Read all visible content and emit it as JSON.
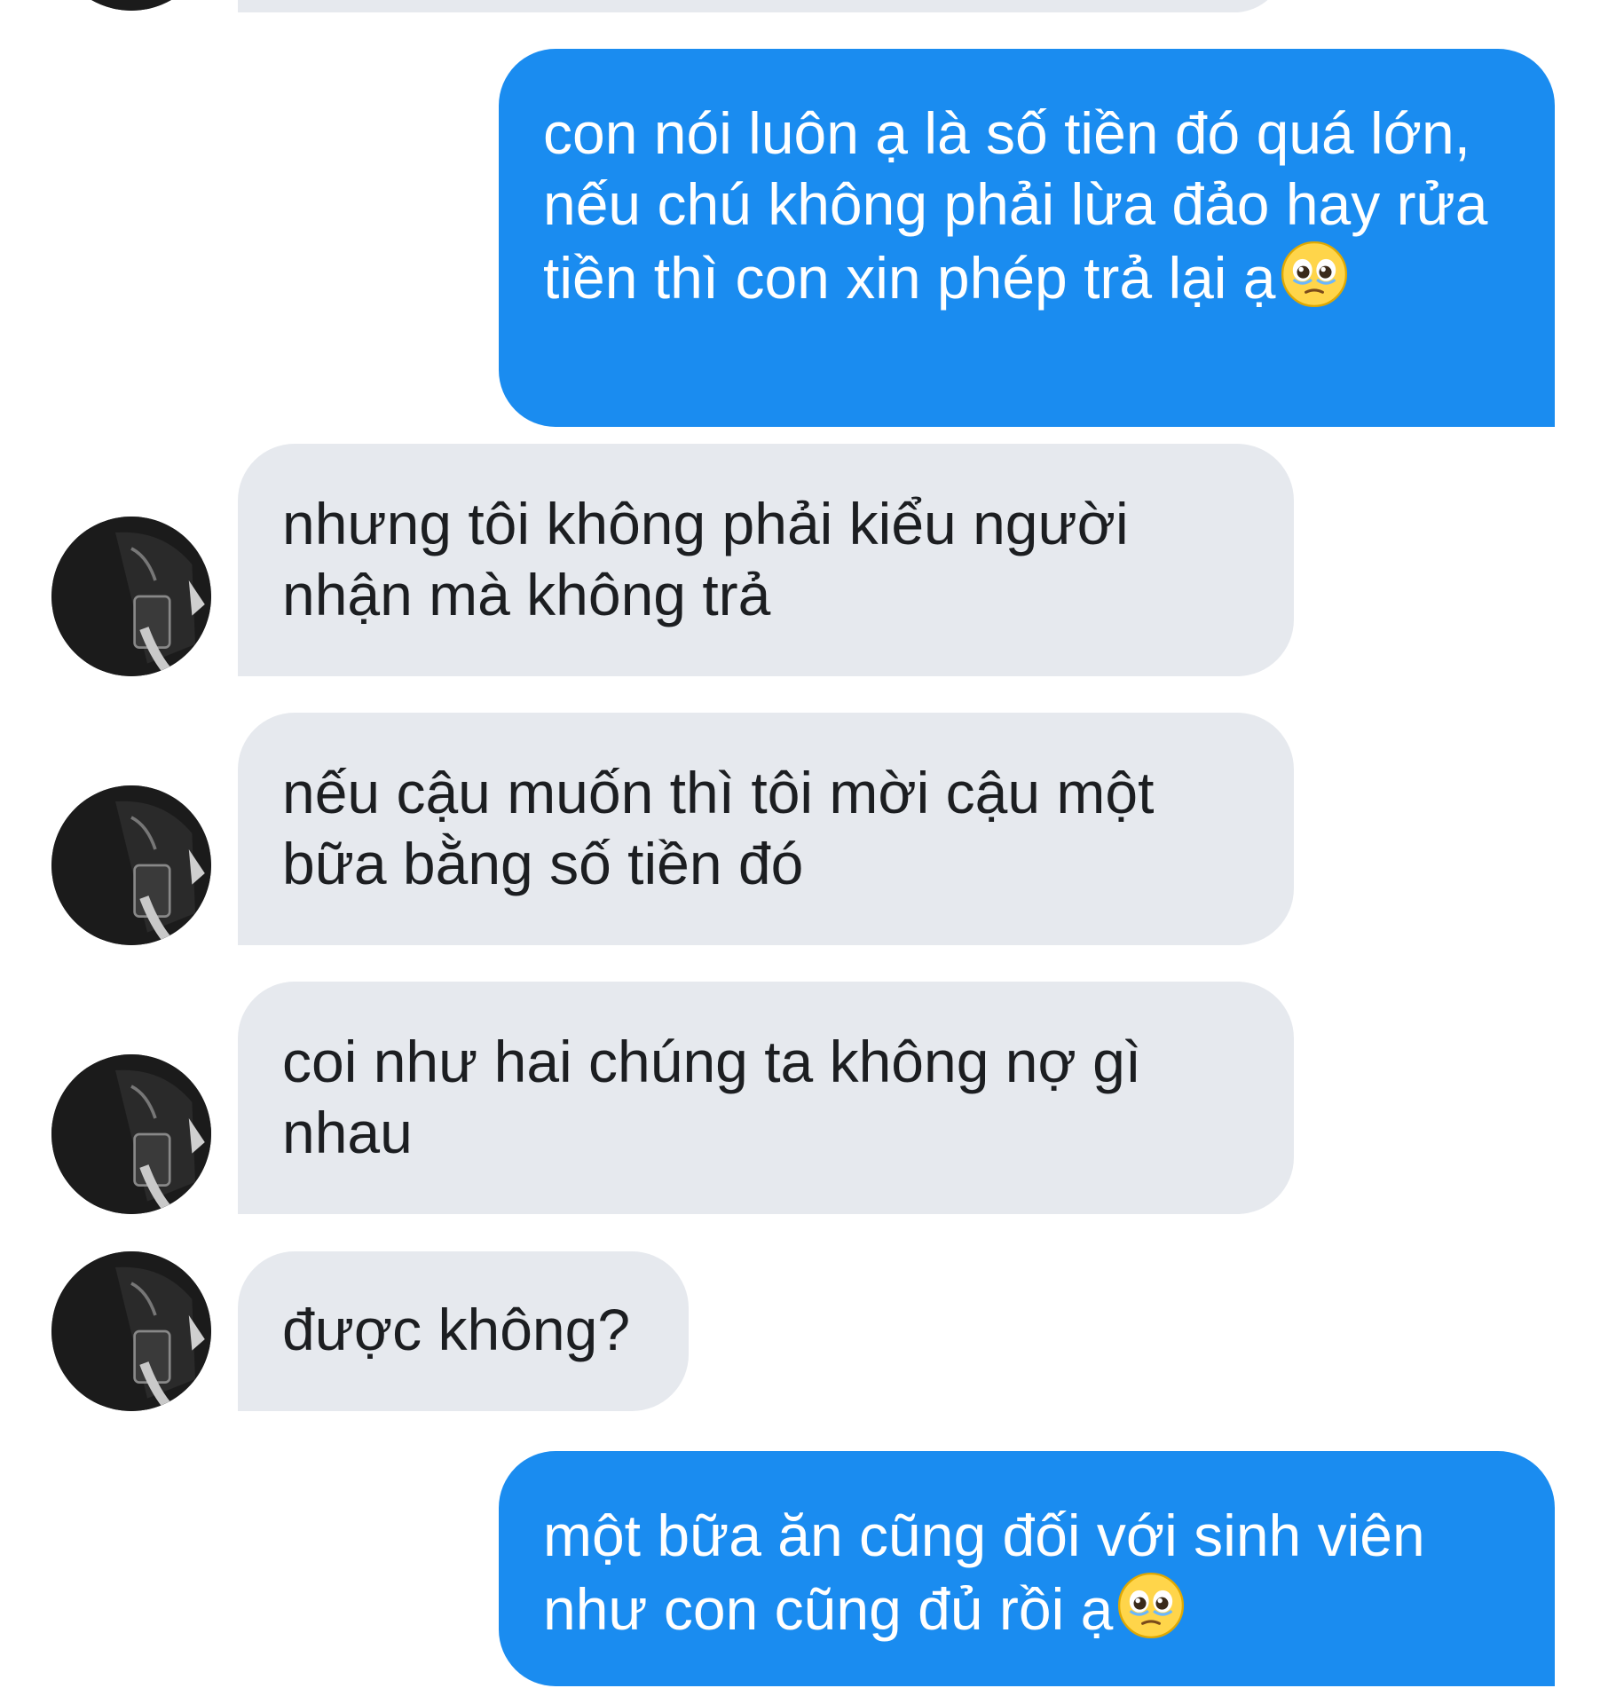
{
  "conversation": {
    "messages": [
      {
        "sender": "me",
        "text": "con nói luôn ạ là số tiền đó quá lớn, nếu chú không phải lừa đảo hay rửa tiền thì con xin phép trả lại ạ",
        "emoji": "pleading-face"
      },
      {
        "sender": "them",
        "text": "nhưng tôi không phải kiểu người nhận mà không trả"
      },
      {
        "sender": "them",
        "text": "nếu cậu muốn thì tôi mời cậu một bữa bằng số tiền đó"
      },
      {
        "sender": "them",
        "text": "coi như hai chúng ta không nợ gì nhau"
      },
      {
        "sender": "them",
        "text": "được không?"
      },
      {
        "sender": "me",
        "text": "một bữa ăn cũng đối với sinh viên như con cũng đủ rồi ạ",
        "emoji": "pleading-face"
      }
    ]
  },
  "colors": {
    "outgoing_bubble": "#1a8cf0",
    "incoming_bubble": "#e6e9ee",
    "incoming_text": "#1c1e21"
  }
}
